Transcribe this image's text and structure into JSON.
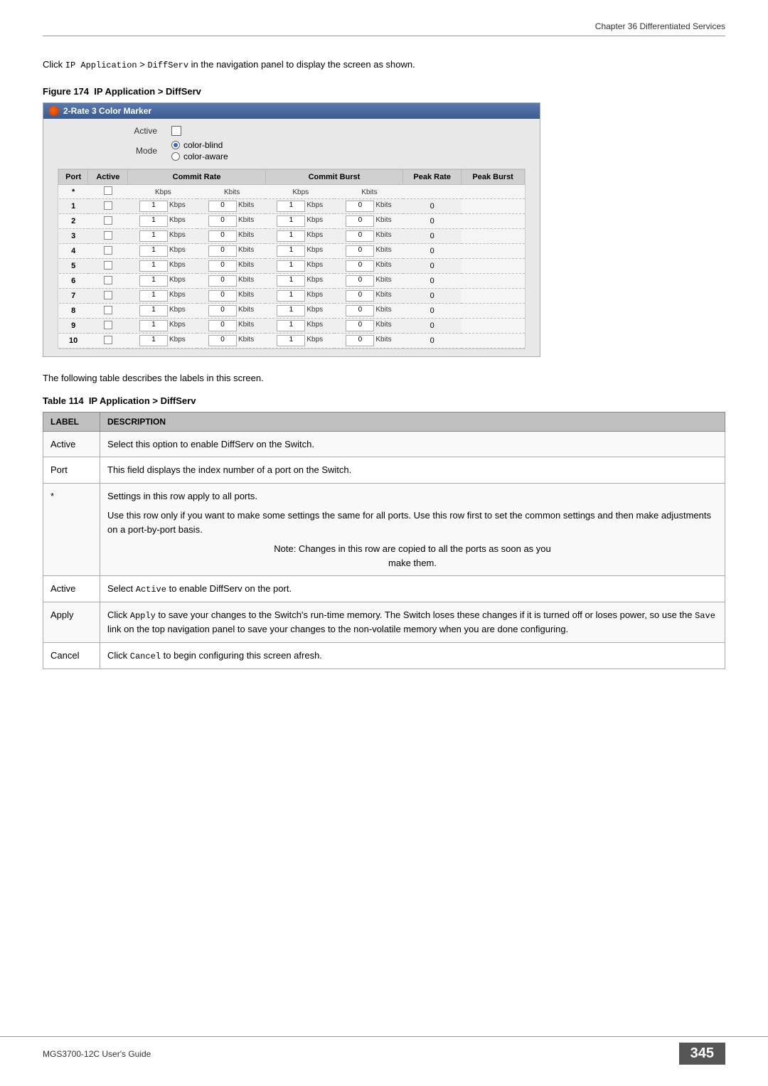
{
  "header": {
    "chapter": "Chapter 36 Differentiated Services"
  },
  "intro": {
    "text": "Click IP Application > DiffServ in the navigation panel to display the screen as shown."
  },
  "figure": {
    "label": "Figure 174",
    "title": "IP Application > DiffServ",
    "panel_title": "2-Rate 3 Color Marker",
    "active_label": "Active",
    "mode_label": "Mode",
    "color_blind": "color-blind",
    "color_aware": "color-aware",
    "table": {
      "headers": [
        "Port",
        "Active",
        "Commit Rate",
        "Commit Burst",
        "Peak Rate",
        "Peak Burst"
      ],
      "unit_kbps": "Kbps",
      "unit_kbits": "Kbits",
      "rows": [
        {
          "port": "*",
          "active": false,
          "commit_rate": "",
          "commit_burst": "",
          "peak_rate": "",
          "peak_burst": ""
        },
        {
          "port": "1",
          "active": false,
          "commit_rate": "1",
          "commit_burst": "0",
          "peak_rate": "1",
          "peak_burst": "0"
        },
        {
          "port": "2",
          "active": false,
          "commit_rate": "1",
          "commit_burst": "0",
          "peak_rate": "1",
          "peak_burst": "0"
        },
        {
          "port": "3",
          "active": false,
          "commit_rate": "1",
          "commit_burst": "0",
          "peak_rate": "1",
          "peak_burst": "0"
        },
        {
          "port": "4",
          "active": false,
          "commit_rate": "1",
          "commit_burst": "0",
          "peak_rate": "1",
          "peak_burst": "0"
        },
        {
          "port": "5",
          "active": false,
          "commit_rate": "1",
          "commit_burst": "0",
          "peak_rate": "1",
          "peak_burst": "0"
        },
        {
          "port": "6",
          "active": false,
          "commit_rate": "1",
          "commit_burst": "0",
          "peak_rate": "1",
          "peak_burst": "0"
        },
        {
          "port": "7",
          "active": false,
          "commit_rate": "1",
          "commit_burst": "0",
          "peak_rate": "1",
          "peak_burst": "0"
        },
        {
          "port": "8",
          "active": false,
          "commit_rate": "1",
          "commit_burst": "0",
          "peak_rate": "1",
          "peak_burst": "0"
        },
        {
          "port": "9",
          "active": false,
          "commit_rate": "1",
          "commit_burst": "0",
          "peak_rate": "1",
          "peak_burst": "0"
        },
        {
          "port": "10",
          "active": false,
          "commit_rate": "1",
          "commit_burst": "0",
          "peak_rate": "1",
          "peak_burst": "0"
        }
      ]
    }
  },
  "desc_text": "The following table describes the labels in this screen.",
  "ref_table": {
    "label": "Table 114",
    "title": "IP Application > DiffServ",
    "col_label": "LABEL",
    "col_desc": "DESCRIPTION",
    "rows": [
      {
        "label": "Active",
        "description": "Select this option to enable DiffServ on the Switch."
      },
      {
        "label": "Port",
        "description": "This field displays the index number of a port on the Switch."
      },
      {
        "label": "*",
        "description_parts": [
          "Settings in this row apply to all ports.",
          "Use this row only if you want to make some settings the same for all ports. Use this row first to set the common settings and then make adjustments on a port-by-port basis.",
          "note"
        ],
        "note": "Note: Changes in this row are copied to all the ports as soon as you make them."
      },
      {
        "label": "Active",
        "description": "Select Active to enable DiffServ on the port."
      },
      {
        "label": "Apply",
        "description": "Click Apply to save your changes to the Switch's run-time memory. The Switch loses these changes if it is turned off or loses power, so use the Save link on the top navigation panel to save your changes to the non-volatile memory when you are done configuring."
      },
      {
        "label": "Cancel",
        "description": "Click Cancel to begin configuring this screen afresh."
      }
    ]
  },
  "footer": {
    "left": "MGS3700-12C User's Guide",
    "right": "345"
  }
}
